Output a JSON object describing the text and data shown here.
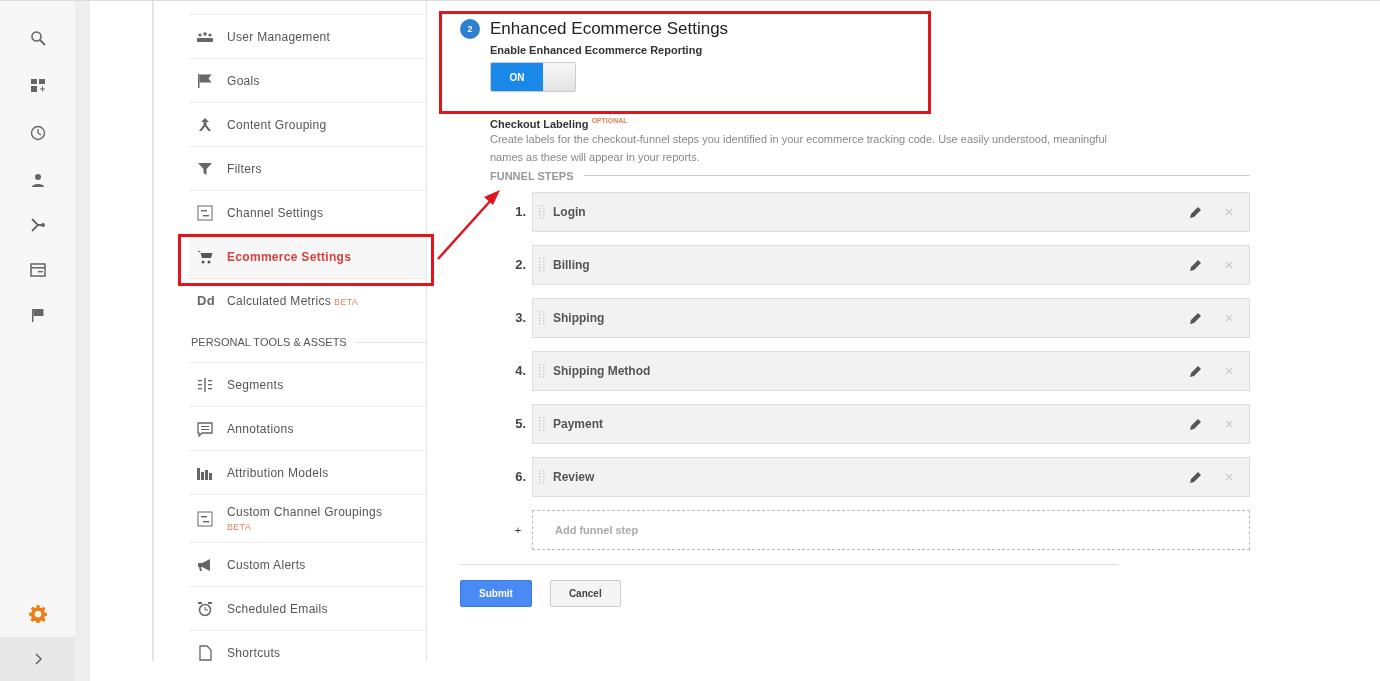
{
  "nav": {
    "items": [
      {
        "kind": "item",
        "label": "User Management",
        "selected": false
      },
      {
        "kind": "item",
        "label": "Goals",
        "selected": false
      },
      {
        "kind": "item",
        "label": "Content Grouping",
        "selected": false
      },
      {
        "kind": "item",
        "label": "Filters",
        "selected": false
      },
      {
        "kind": "item",
        "label": "Channel Settings",
        "selected": false
      },
      {
        "kind": "item",
        "label": "Ecommerce Settings",
        "selected": true
      },
      {
        "kind": "item",
        "glyph": "Dd",
        "label": "Calculated Metrics",
        "badge": "BETA",
        "selected": false
      },
      {
        "kind": "section",
        "label": "PERSONAL TOOLS & ASSETS"
      },
      {
        "kind": "item",
        "label": "Segments",
        "selected": false
      },
      {
        "kind": "item",
        "label": "Annotations",
        "selected": false
      },
      {
        "kind": "item",
        "label": "Attribution Models",
        "selected": false
      },
      {
        "kind": "stacked",
        "label": "Custom Channel Groupings",
        "badge": "BETA",
        "selected": false
      },
      {
        "kind": "item",
        "label": "Custom Alerts",
        "selected": false
      },
      {
        "kind": "item",
        "label": "Scheduled Emails",
        "selected": false
      },
      {
        "kind": "item",
        "label": "Shortcuts",
        "selected": false
      }
    ]
  },
  "settings": {
    "step": "2",
    "title": "Enhanced Ecommerce Settings",
    "toggle_label": "Enable Enhanced Ecommerce Reporting",
    "toggle": {
      "label": "ON",
      "on": true
    }
  },
  "checkout": {
    "title": "Checkout Labeling",
    "tag": "OPTIONAL",
    "description": "Create labels for the checkout-funnel steps you identified in your ecommerce tracking code. Use easily understood, meaningful names as these will appear in your reports.",
    "funnel_heading": "FUNNEL STEPS",
    "steps": [
      {
        "number": "1.",
        "label": "Login"
      },
      {
        "number": "2.",
        "label": "Billing"
      },
      {
        "number": "3.",
        "label": "Shipping"
      },
      {
        "number": "4.",
        "label": "Shipping Method"
      },
      {
        "number": "5.",
        "label": "Payment"
      },
      {
        "number": "6.",
        "label": "Review"
      }
    ],
    "add": {
      "symbol": "+",
      "placeholder": "Add funnel step"
    }
  },
  "buttons": [
    {
      "kind": "primary",
      "label": "Submit"
    },
    {
      "kind": "secondary",
      "label": "Cancel"
    }
  ]
}
